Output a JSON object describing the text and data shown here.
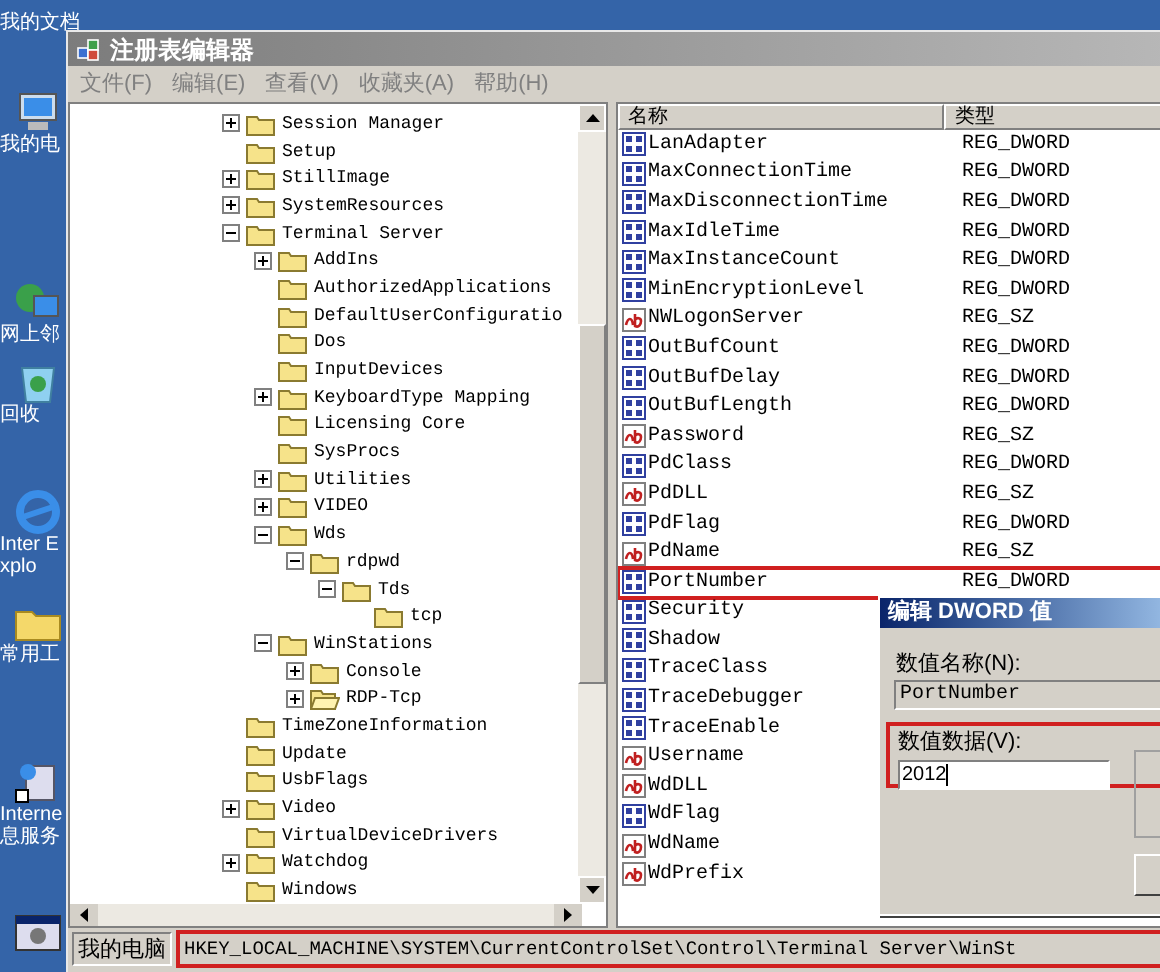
{
  "desktop_icons": [
    {
      "label": "我的文档",
      "kind": "documents"
    },
    {
      "label": "我的电",
      "kind": "computer"
    },
    {
      "label": "网上邻",
      "kind": "network"
    },
    {
      "label": "回收",
      "kind": "recycle"
    },
    {
      "label": "Inter Explo",
      "kind": "browser"
    },
    {
      "label": "常用工",
      "kind": "folder"
    },
    {
      "label": "Interne 息服务",
      "kind": "server"
    },
    {
      "kind": "app"
    }
  ],
  "window": {
    "title": "注册表编辑器"
  },
  "menu": [
    "文件(F)",
    "编辑(E)",
    "查看(V)",
    "收藏夹(A)",
    "帮助(H)"
  ],
  "tree": [
    {
      "label": "Session Manager",
      "selected": false,
      "expanded": false
    },
    {
      "label": "Setup",
      "selected": false
    },
    {
      "label": "StillImage",
      "selected": false,
      "expanded": false
    },
    {
      "label": "SystemResources",
      "selected": false,
      "expanded": false
    },
    {
      "label": "Terminal Server",
      "selected": false,
      "expanded": true,
      "children": [
        {
          "label": "AddIns",
          "selected": false,
          "expanded": false
        },
        {
          "label": "AuthorizedApplications",
          "selected": false
        },
        {
          "label": "DefaultUserConfiguratio",
          "selected": false
        },
        {
          "label": "Dos",
          "selected": false
        },
        {
          "label": "InputDevices",
          "selected": false
        },
        {
          "label": "KeyboardType Mapping",
          "selected": false,
          "expanded": false
        },
        {
          "label": "Licensing Core",
          "selected": false
        },
        {
          "label": "SysProcs",
          "selected": false
        },
        {
          "label": "Utilities",
          "selected": false,
          "expanded": false
        },
        {
          "label": "VIDEO",
          "selected": false,
          "expanded": false
        },
        {
          "label": "Wds",
          "selected": false,
          "expanded": true,
          "children": [
            {
              "label": "rdpwd",
              "selected": false,
              "expanded": true,
              "children": [
                {
                  "label": "Tds",
                  "selected": false,
                  "expanded": true,
                  "children": [
                    {
                      "label": "tcp",
                      "selected": false
                    }
                  ]
                }
              ]
            }
          ]
        },
        {
          "label": "WinStations",
          "selected": false,
          "expanded": true,
          "children": [
            {
              "label": "Console",
              "selected": false,
              "expanded": false
            },
            {
              "label": "RDP-Tcp",
              "selected": true,
              "expanded": false
            }
          ]
        }
      ]
    },
    {
      "label": "TimeZoneInformation",
      "selected": false
    },
    {
      "label": "Update",
      "selected": false
    },
    {
      "label": "UsbFlags",
      "selected": false
    },
    {
      "label": "Video",
      "selected": false,
      "expanded": false
    },
    {
      "label": "VirtualDeviceDrivers",
      "selected": false
    },
    {
      "label": "Watchdog",
      "selected": false,
      "expanded": false
    },
    {
      "label": "Windows",
      "selected": false
    }
  ],
  "values": {
    "columns": [
      "名称",
      "类型"
    ],
    "rows": [
      {
        "name": "LanAdapter",
        "type": "REG_DWORD",
        "kind": "dword",
        "highlighted": false
      },
      {
        "name": "MaxConnectionTime",
        "type": "REG_DWORD",
        "kind": "dword",
        "highlighted": false
      },
      {
        "name": "MaxDisconnectionTime",
        "type": "REG_DWORD",
        "kind": "dword",
        "highlighted": false
      },
      {
        "name": "MaxIdleTime",
        "type": "REG_DWORD",
        "kind": "dword",
        "highlighted": false
      },
      {
        "name": "MaxInstanceCount",
        "type": "REG_DWORD",
        "kind": "dword",
        "highlighted": false
      },
      {
        "name": "MinEncryptionLevel",
        "type": "REG_DWORD",
        "kind": "dword",
        "highlighted": false
      },
      {
        "name": "NWLogonServer",
        "type": "REG_SZ",
        "kind": "sz",
        "highlighted": false
      },
      {
        "name": "OutBufCount",
        "type": "REG_DWORD",
        "kind": "dword",
        "highlighted": false
      },
      {
        "name": "OutBufDelay",
        "type": "REG_DWORD",
        "kind": "dword",
        "highlighted": false
      },
      {
        "name": "OutBufLength",
        "type": "REG_DWORD",
        "kind": "dword",
        "highlighted": false
      },
      {
        "name": "Password",
        "type": "REG_SZ",
        "kind": "sz",
        "highlighted": false
      },
      {
        "name": "PdClass",
        "type": "REG_DWORD",
        "kind": "dword",
        "highlighted": false
      },
      {
        "name": "PdDLL",
        "type": "REG_SZ",
        "kind": "sz",
        "highlighted": false
      },
      {
        "name": "PdFlag",
        "type": "REG_DWORD",
        "kind": "dword",
        "highlighted": false
      },
      {
        "name": "PdName",
        "type": "REG_SZ",
        "kind": "sz",
        "highlighted": false
      },
      {
        "name": "PortNumber",
        "type": "REG_DWORD",
        "kind": "dword",
        "highlighted": true
      },
      {
        "name": "Security",
        "kind": "dword",
        "highlighted": false
      },
      {
        "name": "Shadow",
        "kind": "dword",
        "highlighted": false
      },
      {
        "name": "TraceClass",
        "kind": "dword",
        "highlighted": false
      },
      {
        "name": "TraceDebugger",
        "kind": "dword",
        "highlighted": false
      },
      {
        "name": "TraceEnable",
        "kind": "dword",
        "highlighted": false
      },
      {
        "name": "Username",
        "kind": "sz",
        "highlighted": false
      },
      {
        "name": "WdDLL",
        "kind": "sz",
        "highlighted": false
      },
      {
        "name": "WdFlag",
        "kind": "dword",
        "highlighted": false
      },
      {
        "name": "WdName",
        "kind": "sz",
        "highlighted": false
      },
      {
        "name": "WdPrefix",
        "kind": "sz",
        "highlighted": false
      }
    ]
  },
  "dialog": {
    "title": "编辑 DWORD 值",
    "name_label": "数值名称(N):",
    "name_value": "PortNumber",
    "data_label": "数值数据(V):",
    "data_value": "2012",
    "data_highlighted": true
  },
  "status_bar": {
    "location": "我的电脑",
    "path": "HKEY_LOCAL_MACHINE\\SYSTEM\\CurrentControlSet\\Control\\Terminal Server\\WinSt",
    "path_highlighted": true
  }
}
